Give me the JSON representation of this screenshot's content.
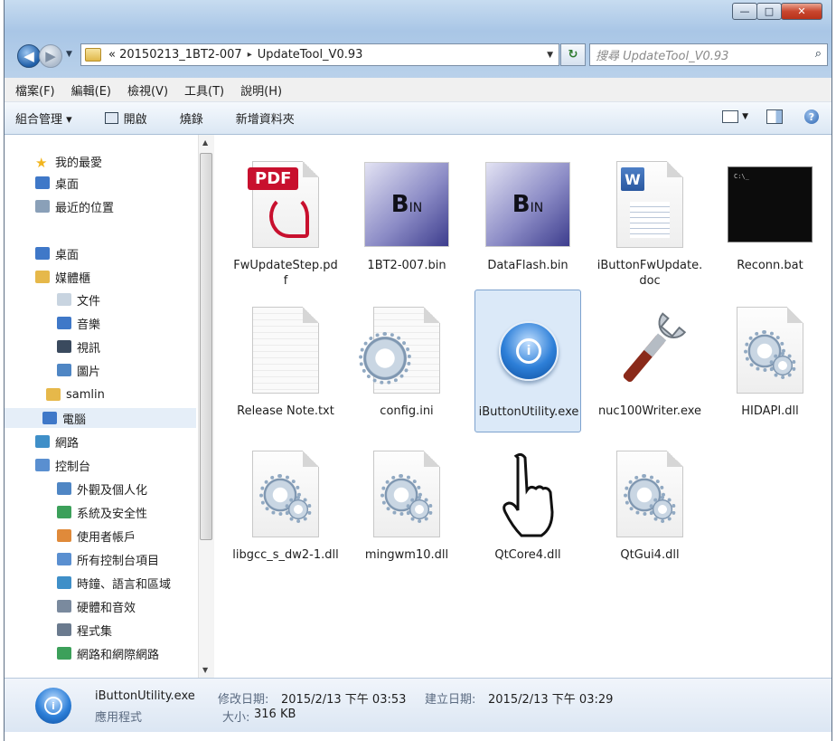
{
  "window": {
    "minimize": "—",
    "maximize": "□",
    "close": "✕"
  },
  "address": {
    "prefix": "«",
    "crumbs": [
      "20150213_1BT2-007",
      "UpdateTool_V0.93"
    ],
    "sep": "▸"
  },
  "search": {
    "placeholder": "搜尋 UpdateTool_V0.93"
  },
  "menu": [
    "檔案(F)",
    "編輯(E)",
    "檢視(V)",
    "工具(T)",
    "說明(H)"
  ],
  "toolbar": {
    "organize": "組合管理 ▾",
    "open": "開啟",
    "burn": "燒錄",
    "new_folder": "新增資料夾"
  },
  "nav": [
    {
      "label": "我的最愛",
      "icon": "star-icon",
      "color": "#f2b51e"
    },
    {
      "label": "桌面",
      "icon": "desktop-icon",
      "color": "#3f78c8"
    },
    {
      "label": "最近的位置",
      "icon": "recent-places-icon",
      "color": "#8aa0b8"
    },
    {
      "label": "桌面",
      "icon": "desktop-icon",
      "color": "#3f78c8"
    },
    {
      "label": "媒體櫃",
      "icon": "library-icon",
      "color": "#e6b84a"
    },
    {
      "label": "文件",
      "icon": "documents-icon",
      "color": "#c8d4e0"
    },
    {
      "label": "音樂",
      "icon": "music-icon",
      "color": "#3f78c8"
    },
    {
      "label": "視訊",
      "icon": "video-icon",
      "color": "#3a4a5e"
    },
    {
      "label": "圖片",
      "icon": "pictures-icon",
      "color": "#4f86c4"
    },
    {
      "label": "samlin",
      "icon": "user-folder-icon",
      "color": "#e6b84a"
    },
    {
      "label": "電腦",
      "icon": "computer-icon",
      "color": "#3f78c8"
    },
    {
      "label": "網路",
      "icon": "network-icon",
      "color": "#3f8fc8"
    },
    {
      "label": "控制台",
      "icon": "control-panel-icon",
      "color": "#5a8fd0"
    },
    {
      "label": "外觀及個人化",
      "icon": "personalize-icon",
      "color": "#4f86c4"
    },
    {
      "label": "系統及安全性",
      "icon": "security-icon",
      "color": "#3ca05a"
    },
    {
      "label": "使用者帳戶",
      "icon": "users-icon",
      "color": "#e08a3a"
    },
    {
      "label": "所有控制台項目",
      "icon": "control-panel-icon",
      "color": "#5a8fd0"
    },
    {
      "label": "時鐘、語言和區域",
      "icon": "clock-globe-icon",
      "color": "#3f8fc8"
    },
    {
      "label": "硬體和音效",
      "icon": "hardware-icon",
      "color": "#7a8a9e"
    },
    {
      "label": "程式集",
      "icon": "programs-icon",
      "color": "#6a7a8e"
    },
    {
      "label": "網路和網際網路",
      "icon": "internet-icon",
      "color": "#3ca05a"
    }
  ],
  "files": [
    {
      "name": "FwUpdateStep.pdf",
      "kind": "pdf",
      "badge": "PDF"
    },
    {
      "name": "1BT2-007.bin",
      "kind": "bin",
      "badge": "B",
      "badge2": "IN"
    },
    {
      "name": "DataFlash.bin",
      "kind": "bin",
      "badge": "B",
      "badge2": "IN"
    },
    {
      "name": "iButtonFwUpdate.doc",
      "kind": "word",
      "badge": "W"
    },
    {
      "name": "Reconn.bat",
      "kind": "console",
      "badge": "C:\\_"
    },
    {
      "name": "Release Note.txt",
      "kind": "txt"
    },
    {
      "name": "config.ini",
      "kind": "ini"
    },
    {
      "name": "iButtonUtility.exe",
      "kind": "exe-info",
      "badge": "i"
    },
    {
      "name": "nuc100Writer.exe",
      "kind": "wrench"
    },
    {
      "name": "HIDAPI.dll",
      "kind": "dll"
    },
    {
      "name": "libgcc_s_dw2-1.dll",
      "kind": "dll"
    },
    {
      "name": "mingwm10.dll",
      "kind": "dll"
    },
    {
      "name": "QtCore4.dll",
      "kind": "hand"
    },
    {
      "name": "QtGui4.dll",
      "kind": "dll"
    }
  ],
  "status": {
    "filename": "iButtonUtility.exe",
    "modified_label": "修改日期:",
    "modified": "2015/2/13 下午 03:53",
    "created_label": "建立日期:",
    "created": "2015/2/13 下午 03:29",
    "type": "應用程式",
    "size_label": "大小:",
    "size": "316 KB",
    "icon_glyph": "i"
  },
  "colors": {
    "selection": "#dbe9f8",
    "accent": "#2d7fd8",
    "pdf": "#c8102e"
  }
}
